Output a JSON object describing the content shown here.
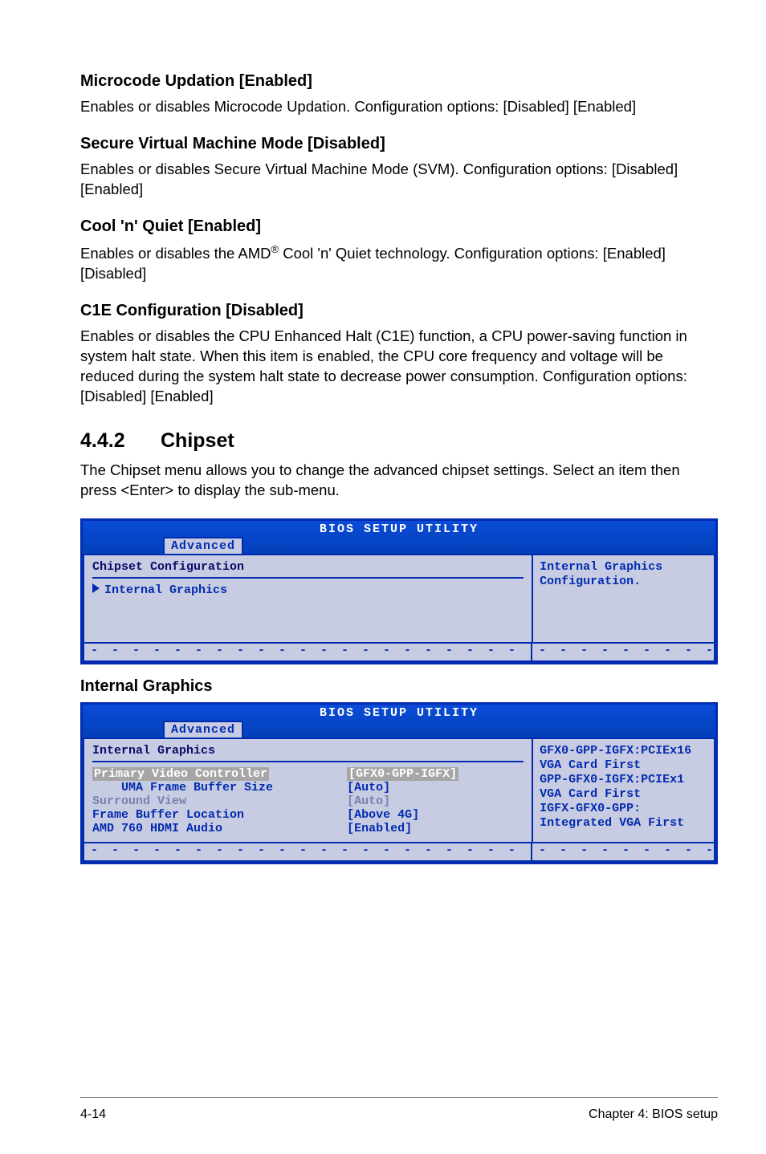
{
  "sections": {
    "microcode": {
      "title": "Microcode Updation [Enabled]",
      "body": "Enables or disables Microcode Updation. Configuration options: [Disabled] [Enabled]"
    },
    "svm": {
      "title": "Secure Virtual Machine Mode [Disabled]",
      "body": "Enables or disables Secure Virtual Machine Mode (SVM). Configuration options: [Disabled] [Enabled]"
    },
    "cnq": {
      "title": "Cool 'n' Quiet [Enabled]",
      "body_pre": "Enables or disables the AMD",
      "body_post": " Cool 'n' Quiet technology. Configuration options: [Enabled] [Disabled]"
    },
    "c1e": {
      "title": "C1E Configuration [Disabled]",
      "body": "Enables or disables the CPU Enhanced Halt (C1E) function, a CPU power-saving function in system halt state. When this item is enabled, the CPU core frequency and voltage will be reduced during the system halt state to decrease power consumption. Configuration options: [Disabled] [Enabled]"
    }
  },
  "chipset": {
    "num": "4.4.2",
    "title": "Chipset",
    "intro": "The Chipset menu allows you to change the advanced chipset settings. Select an item then press <Enter> to display the sub-menu."
  },
  "bios1": {
    "title": "BIOS SETUP UTILITY",
    "tab": "Advanced",
    "group": "Chipset Configuration",
    "item": "Internal Graphics",
    "help1": "Internal Graphics",
    "help2": "Configuration."
  },
  "ig_heading": "Internal Graphics",
  "bios2": {
    "title": "BIOS SETUP UTILITY",
    "tab": "Advanced",
    "group": "Internal Graphics",
    "rows": [
      {
        "label": "Primary Video Controller",
        "value": "[GFX0-GPP-IGFX]",
        "sel": true
      },
      {
        "label": "    UMA Frame Buffer Size",
        "value": "[Auto]"
      },
      {
        "label": "Surround View",
        "value": "[Auto]",
        "dim": true
      },
      {
        "label": "Frame Buffer Location",
        "value": "[Above 4G]"
      },
      {
        "label": "AMD 760 HDMI Audio",
        "value": "[Enabled]"
      }
    ],
    "help": [
      "GFX0-GPP-IGFX:PCIEx16",
      "VGA Card First",
      "GPP-GFX0-IGFX:PCIEx1",
      "VGA Card First",
      "IGFX-GFX0-GPP:",
      "Integrated VGA First"
    ]
  },
  "footer": {
    "left": "4-14",
    "right": "Chapter 4: BIOS setup"
  }
}
